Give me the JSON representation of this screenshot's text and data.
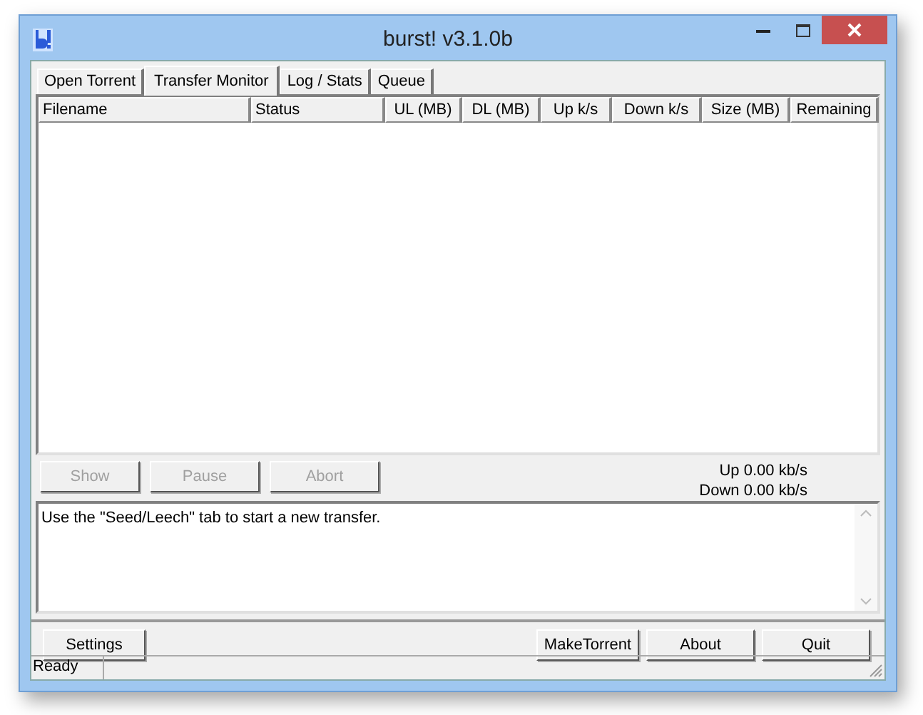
{
  "window": {
    "title": "burst! v3.1.0b"
  },
  "tabs": [
    {
      "label": "Open Torrent",
      "selected": false
    },
    {
      "label": "Transfer Monitor",
      "selected": true
    },
    {
      "label": "Log / Stats",
      "selected": false
    },
    {
      "label": "Queue",
      "selected": false
    }
  ],
  "table": {
    "columns": [
      "Filename",
      "Status",
      "UL (MB)",
      "DL (MB)",
      "Up k/s",
      "Down k/s",
      "Size (MB)",
      "Remaining"
    ]
  },
  "transfer_buttons": [
    {
      "label": "Show",
      "disabled": true
    },
    {
      "label": "Pause",
      "disabled": true
    },
    {
      "label": "Abort",
      "disabled": true
    }
  ],
  "speeds": {
    "up": "Up 0.00 kb/s",
    "down": "Down 0.00 kb/s"
  },
  "log": {
    "text": "Use the \"Seed/Leech\" tab to start a new transfer."
  },
  "left_buttons": [
    {
      "label": "Settings",
      "disabled": false
    }
  ],
  "right_buttons": [
    {
      "label": "MakeTorrent",
      "disabled": false
    },
    {
      "label": "About",
      "disabled": false
    },
    {
      "label": "Quit",
      "disabled": false
    }
  ],
  "status_bar": {
    "text": "Ready"
  }
}
